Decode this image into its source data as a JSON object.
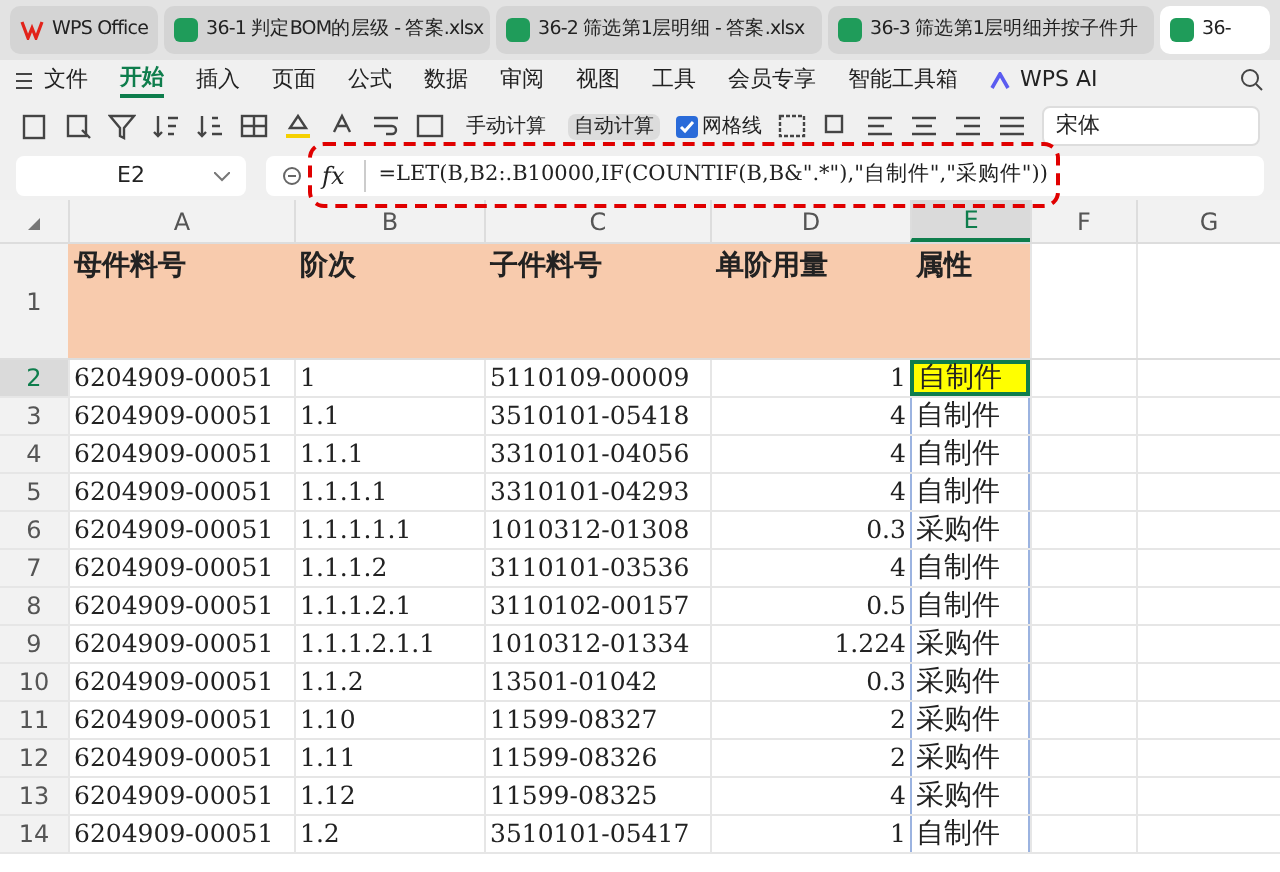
{
  "tabs": [
    {
      "kind": "home",
      "label": "WPS Office",
      "selected": false
    },
    {
      "kind": "doc",
      "label": "36-1 判定BOM的层级 - 答案.xlsx",
      "selected": false
    },
    {
      "kind": "doc",
      "label": "36-2 筛选第1层明细 - 答案.xlsx",
      "selected": false
    },
    {
      "kind": "doc",
      "label": "36-3 筛选第1层明细并按子件升",
      "selected": false
    },
    {
      "kind": "doc",
      "label": "36-",
      "selected": true
    }
  ],
  "menu": [
    {
      "label": "文件",
      "kind": "file",
      "selected": false
    },
    {
      "label": "开始",
      "kind": "tab",
      "selected": true
    },
    {
      "label": "插入",
      "kind": "tab",
      "selected": false
    },
    {
      "label": "页面",
      "kind": "tab",
      "selected": false
    },
    {
      "label": "公式",
      "kind": "tab",
      "selected": false
    },
    {
      "label": "数据",
      "kind": "tab",
      "selected": false
    },
    {
      "label": "审阅",
      "kind": "tab",
      "selected": false
    },
    {
      "label": "视图",
      "kind": "tab",
      "selected": false
    },
    {
      "label": "工具",
      "kind": "tab",
      "selected": false
    },
    {
      "label": "会员专享",
      "kind": "tab",
      "selected": false
    },
    {
      "label": "智能工具箱",
      "kind": "tab",
      "selected": false
    },
    {
      "label": "WPS AI",
      "kind": "ai",
      "selected": false
    }
  ],
  "toolbar": {
    "manual_calc": {
      "label": "手动计算",
      "selected": false
    },
    "auto_calc": {
      "label": "自动计算",
      "selected": true
    },
    "gridlines": {
      "label": "网格线",
      "checked": true
    },
    "font": "宋体"
  },
  "formula_bar": {
    "name_box": "E2",
    "fx": "fx",
    "formula": "=LET(B,B2:.B10000,IF(COUNTIF(B,B&\".*\"),\"自制件\",\"采购件\"))"
  },
  "columns": [
    {
      "label": "A",
      "selected": false
    },
    {
      "label": "B",
      "selected": false
    },
    {
      "label": "C",
      "selected": false
    },
    {
      "label": "D",
      "selected": false
    },
    {
      "label": "E",
      "selected": true
    },
    {
      "label": "F",
      "selected": false
    },
    {
      "label": "G",
      "selected": false
    }
  ],
  "header_row": {
    "number": "1",
    "cells": [
      "母件料号",
      "阶次",
      "子件料号",
      "单阶用量",
      "属性"
    ]
  },
  "rows": [
    {
      "number": "2",
      "a": "6204909-00051",
      "b": "1",
      "c": "5110109-00009",
      "d": "1",
      "e": "自制件",
      "selected": true
    },
    {
      "number": "3",
      "a": "6204909-00051",
      "b": "1.1",
      "c": "3510101-05418",
      "d": "4",
      "e": "自制件",
      "selected": false
    },
    {
      "number": "4",
      "a": "6204909-00051",
      "b": "1.1.1",
      "c": "3310101-04056",
      "d": "4",
      "e": "自制件",
      "selected": false
    },
    {
      "number": "5",
      "a": "6204909-00051",
      "b": "1.1.1.1",
      "c": "3310101-04293",
      "d": "4",
      "e": "自制件",
      "selected": false
    },
    {
      "number": "6",
      "a": "6204909-00051",
      "b": "1.1.1.1.1",
      "c": "1010312-01308",
      "d": "0.3",
      "e": "采购件",
      "selected": false
    },
    {
      "number": "7",
      "a": "6204909-00051",
      "b": "1.1.1.2",
      "c": "3110101-03536",
      "d": "4",
      "e": "自制件",
      "selected": false
    },
    {
      "number": "8",
      "a": "6204909-00051",
      "b": "1.1.1.2.1",
      "c": "3110102-00157",
      "d": "0.5",
      "e": "自制件",
      "selected": false
    },
    {
      "number": "9",
      "a": "6204909-00051",
      "b": "1.1.1.2.1.1",
      "c": "1010312-01334",
      "d": "1.224",
      "e": "采购件",
      "selected": false
    },
    {
      "number": "10",
      "a": "6204909-00051",
      "b": "1.1.2",
      "c": "13501-01042",
      "d": "0.3",
      "e": "采购件",
      "selected": false
    },
    {
      "number": "11",
      "a": "6204909-00051",
      "b": "1.10",
      "c": "11599-08327",
      "d": "2",
      "e": "采购件",
      "selected": false
    },
    {
      "number": "12",
      "a": "6204909-00051",
      "b": "1.11",
      "c": "11599-08326",
      "d": "2",
      "e": "采购件",
      "selected": false
    },
    {
      "number": "13",
      "a": "6204909-00051",
      "b": "1.12",
      "c": "11599-08325",
      "d": "4",
      "e": "采购件",
      "selected": false
    },
    {
      "number": "14",
      "a": "6204909-00051",
      "b": "1.2",
      "c": "3510101-05417",
      "d": "1",
      "e": "自制件",
      "selected": false
    }
  ]
}
